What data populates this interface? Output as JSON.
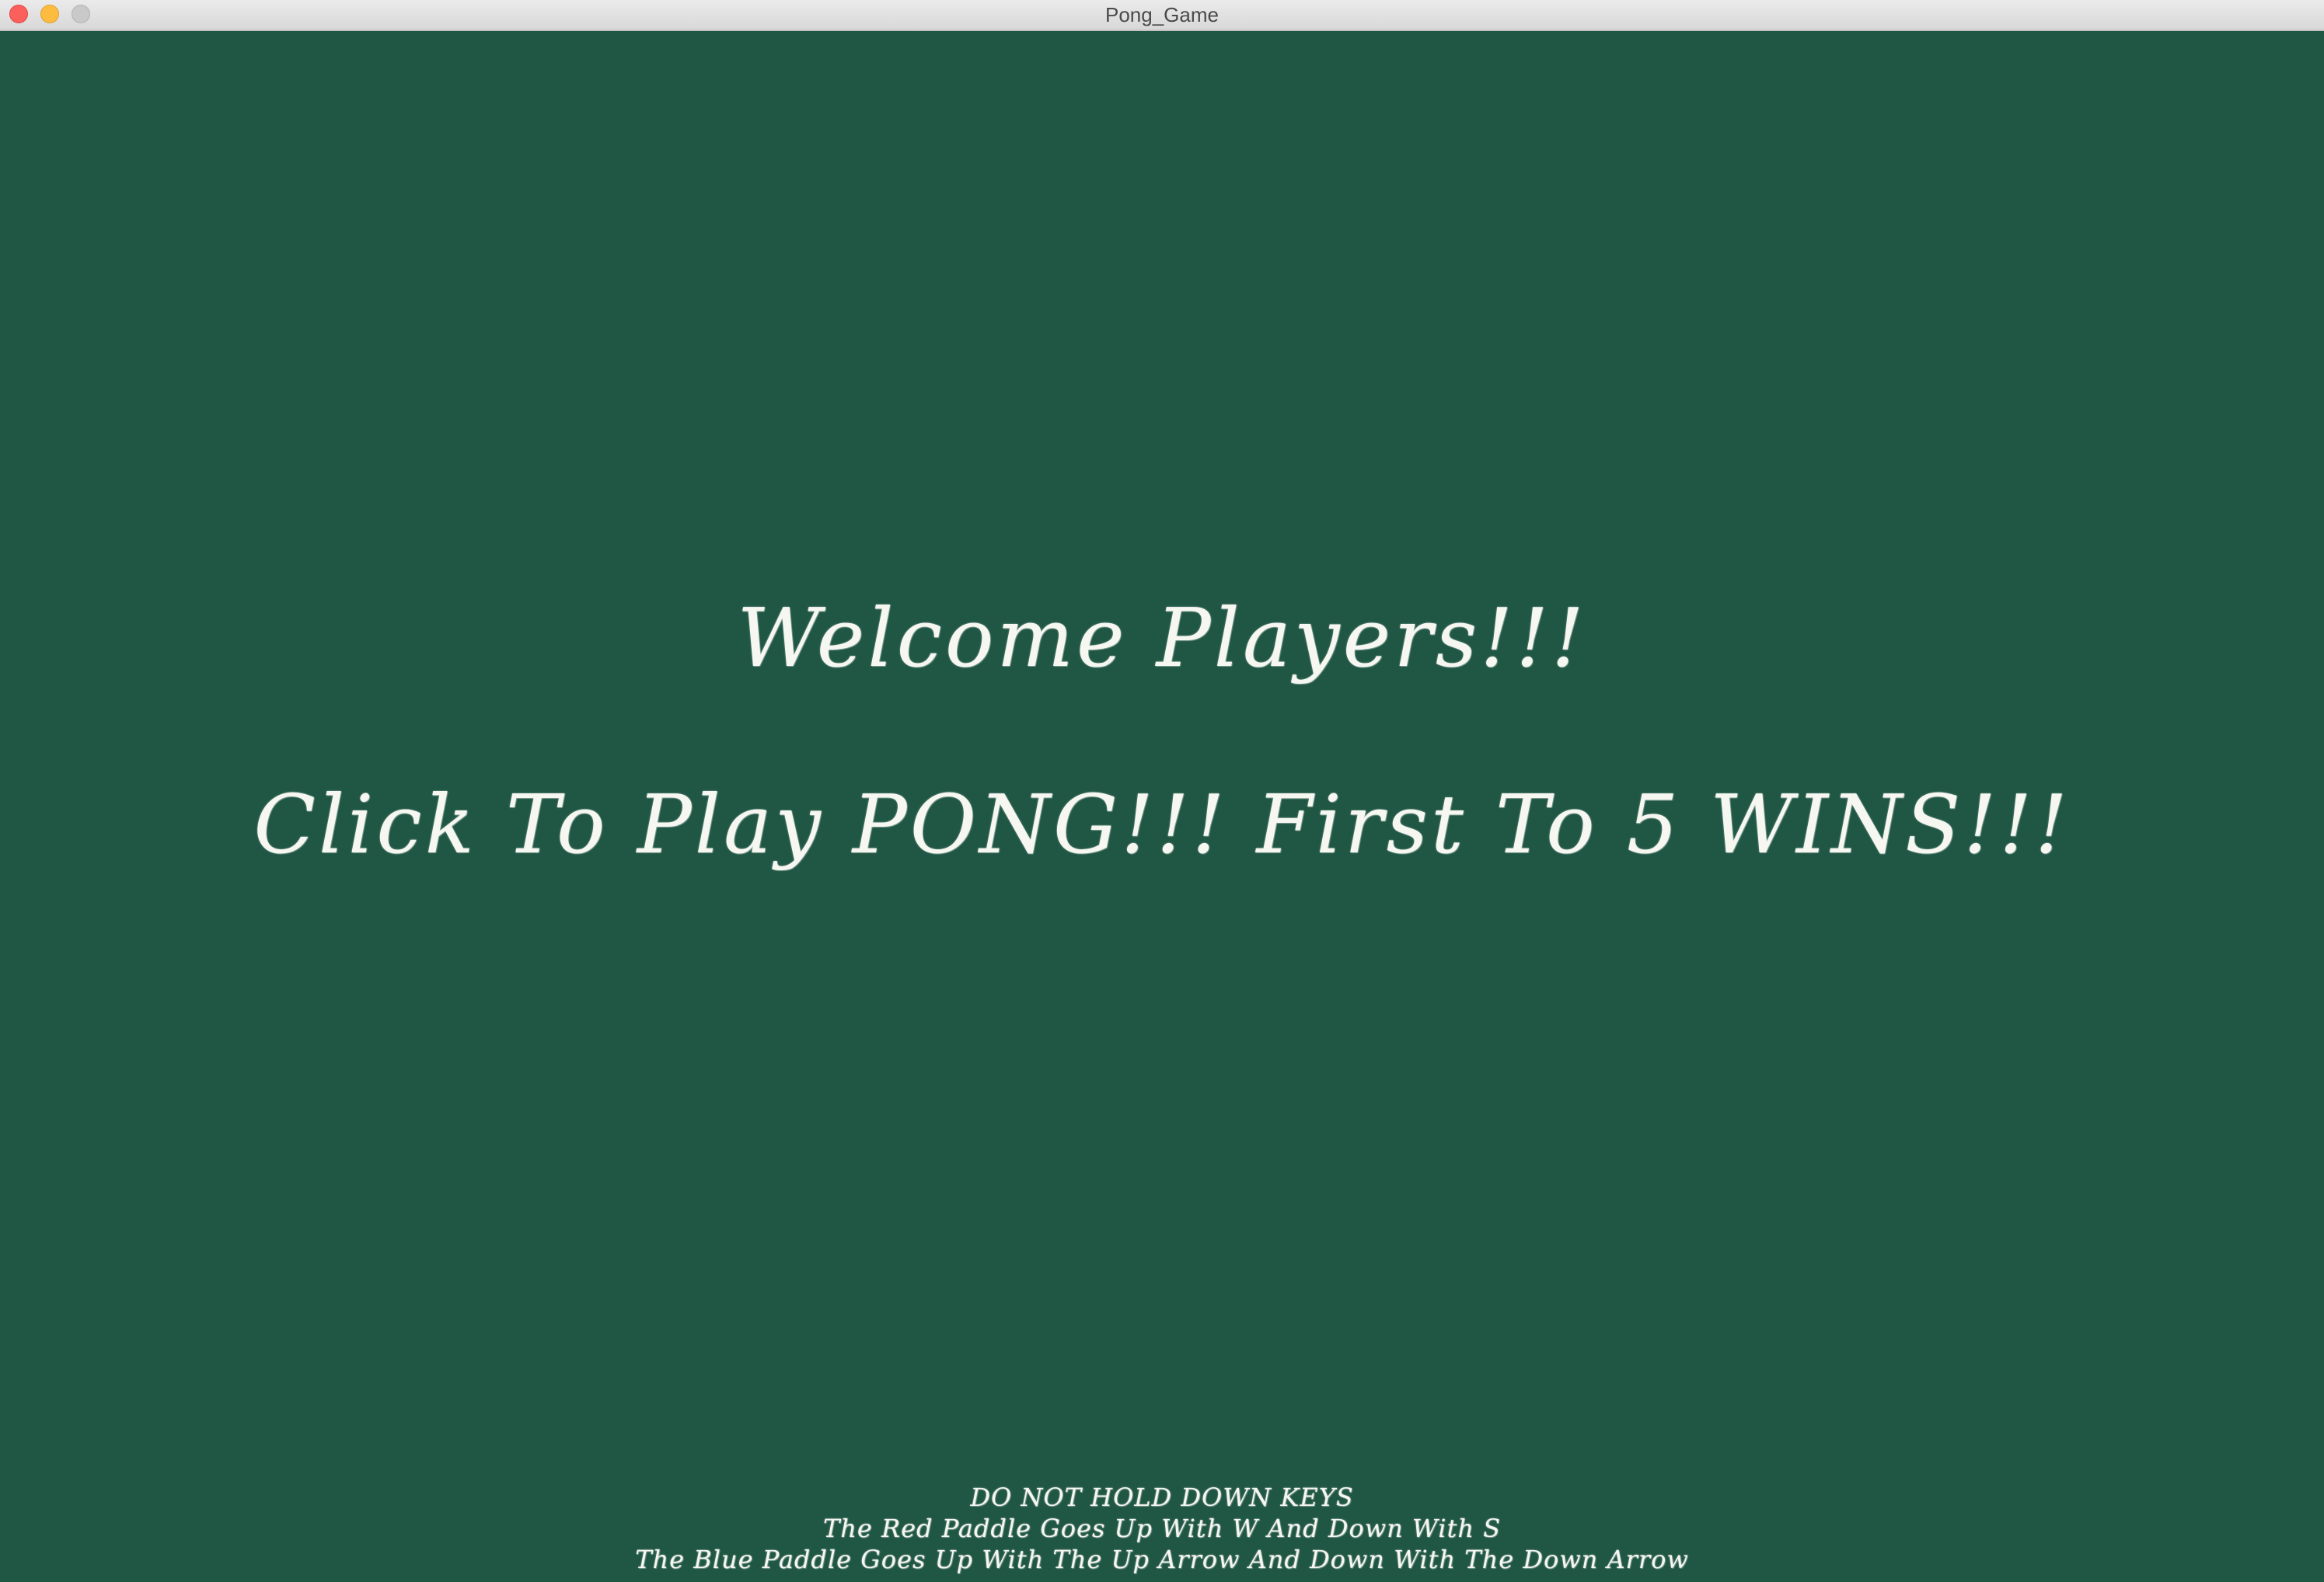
{
  "window": {
    "title": "Pong_Game"
  },
  "game": {
    "welcome": "Welcome Players!!!",
    "prompt": "Click To Play PONG!!! First To 5 WINS!!!",
    "instructions": [
      "DO NOT HOLD DOWN KEYS",
      "The Red Paddle Goes Up With W And Down With S",
      "The Blue Paddle Goes Up With The Up Arrow And Down With The Down Arrow"
    ]
  },
  "colors": {
    "background": "#1f5644",
    "chalk": "#f7f7f2"
  }
}
